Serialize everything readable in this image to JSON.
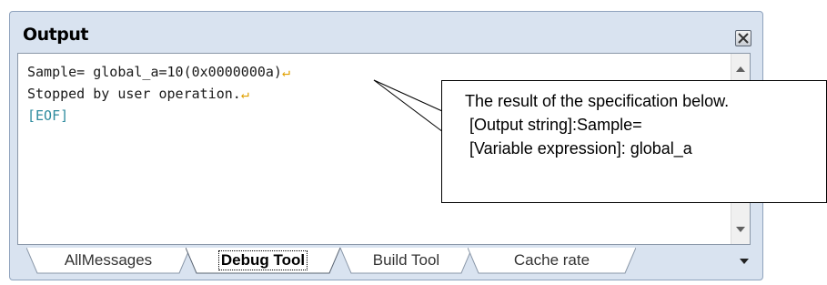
{
  "panel": {
    "title": "Output",
    "close_icon": "close-icon"
  },
  "output": {
    "lines": [
      {
        "text": "Sample= global_a=10(0x0000000a)",
        "eol": "↵"
      },
      {
        "text": "Stopped by user operation.",
        "eol": "↵"
      },
      {
        "text": "[EOF]",
        "eol": ""
      }
    ]
  },
  "tabs": [
    {
      "label": "AllMessages",
      "selected": false
    },
    {
      "label": "Debug Tool",
      "selected": true
    },
    {
      "label": "Build Tool",
      "selected": false
    },
    {
      "label": "Cache rate",
      "selected": false
    }
  ],
  "callout": {
    "line1": "The result of the specification below.",
    "line2": "[Output string]:Sample=",
    "line3": "[Variable expression]: global_a"
  },
  "colors": {
    "panel_bg": "#d9e3f0",
    "eof_text": "#2e8b9e",
    "eol_mark": "#e0a000"
  }
}
